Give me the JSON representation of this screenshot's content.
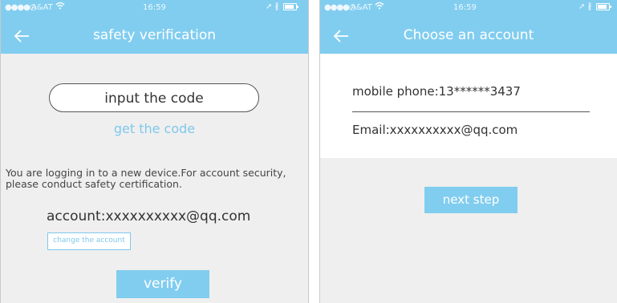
{
  "left": {
    "status": {
      "signal": "●●●●○",
      "carrier": "A&AT",
      "time": "16:59"
    },
    "title": "safety verification",
    "code_placeholder": "input the code",
    "get_code": "get the code",
    "notice": "You are logging in to a new device.For account security, please conduct safety certification.",
    "account": "account:xxxxxxxxxx@qq.com",
    "change_account": "change the account",
    "verify": "verify"
  },
  "right": {
    "status": {
      "signal": "●●●●○",
      "carrier": "A&AT",
      "time": "16:59"
    },
    "title": "Choose an account",
    "accounts": [
      {
        "label": "mobile phone:13******3437"
      },
      {
        "label": "Email:xxxxxxxxxx@qq.com"
      }
    ],
    "next_step": "next step"
  },
  "colors": {
    "accent": "#81cdef",
    "background": "#efefef"
  },
  "icons": {
    "back": "back-arrow-icon",
    "wifi": "wifi-icon",
    "location": "location-arrow-icon",
    "bluetooth": "bluetooth-icon",
    "battery": "battery-icon"
  }
}
